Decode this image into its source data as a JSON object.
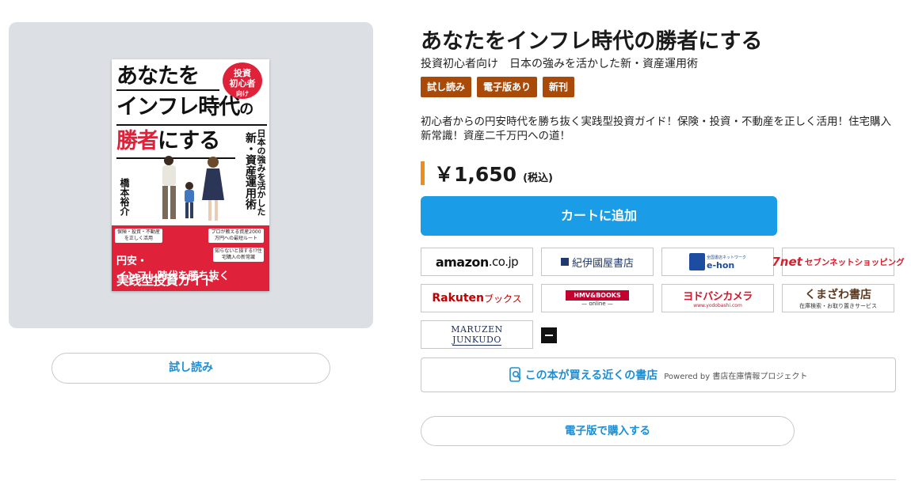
{
  "cover": {
    "line1": "あなたを",
    "line2_main": "インフレ時代",
    "line2_suffix": "の",
    "line3_red": "勝者",
    "line3_black": "にする",
    "badge_line1": "投資",
    "badge_line2": "初心者",
    "badge_line3": "向け",
    "vertical_subtitle": "日本の強みを活かした",
    "vertical_main": "新・資産運用術",
    "author": "橋本裕介",
    "tag1": "保険・投資・不動産を正しく活用",
    "tag2": "プロが教える資産2000万円への最短ルート",
    "tag3": "知らないと損する!?住宅購入の新常識",
    "bottom_line1": "円安・",
    "bottom_line2_a": "インフレ時代を勝ち抜く",
    "bottom_line3": "実践型投資ガイド"
  },
  "trial_button": "試し読み",
  "book": {
    "title": "あなたをインフレ時代の勝者にする",
    "subtitle": "投資初心者向け　日本の強みを活かした新・資産運用術",
    "badges": [
      "試し読み",
      "電子版あり",
      "新刊"
    ],
    "description": "初心者からの円安時代を勝ち抜く実践型投資ガイド！保険・投資・不動産を正しく活用！住宅購入新常識！資産二千万円への道！",
    "price": "￥1,650",
    "tax": "(税込)"
  },
  "cart_button": "カートに追加",
  "stores": {
    "amazon_main": "amazon",
    "amazon_suffix": ".co.jp",
    "kinokuniya": "紀伊國屋書店",
    "ehon_sub": "全国書店ネットワーク",
    "ehon": "e-hon",
    "sevennet_mark": "7net",
    "sevennet": "セブンネットショッピング",
    "rakuten_main": "Rakuten",
    "rakuten_suffix": "ブックス",
    "hmv_top": "HMV&BOOKS",
    "hmv_bottom": "— online —",
    "yodobashi_top": "ヨドバシカメラ",
    "yodobashi_bottom": "www.yodobashi.com",
    "kumazawa_top": "くまざわ書店",
    "kumazawa_bottom": "在庫検索・お取り置きサービス",
    "maruzen_top": "MARUZEN",
    "maruzen_bottom": "JUNKUDO"
  },
  "nearby": {
    "main": "この本が買える近くの書店",
    "powered": "Powered by 書店在庫情報プロジェクト"
  },
  "ebook_button": "電子版で購入する"
}
